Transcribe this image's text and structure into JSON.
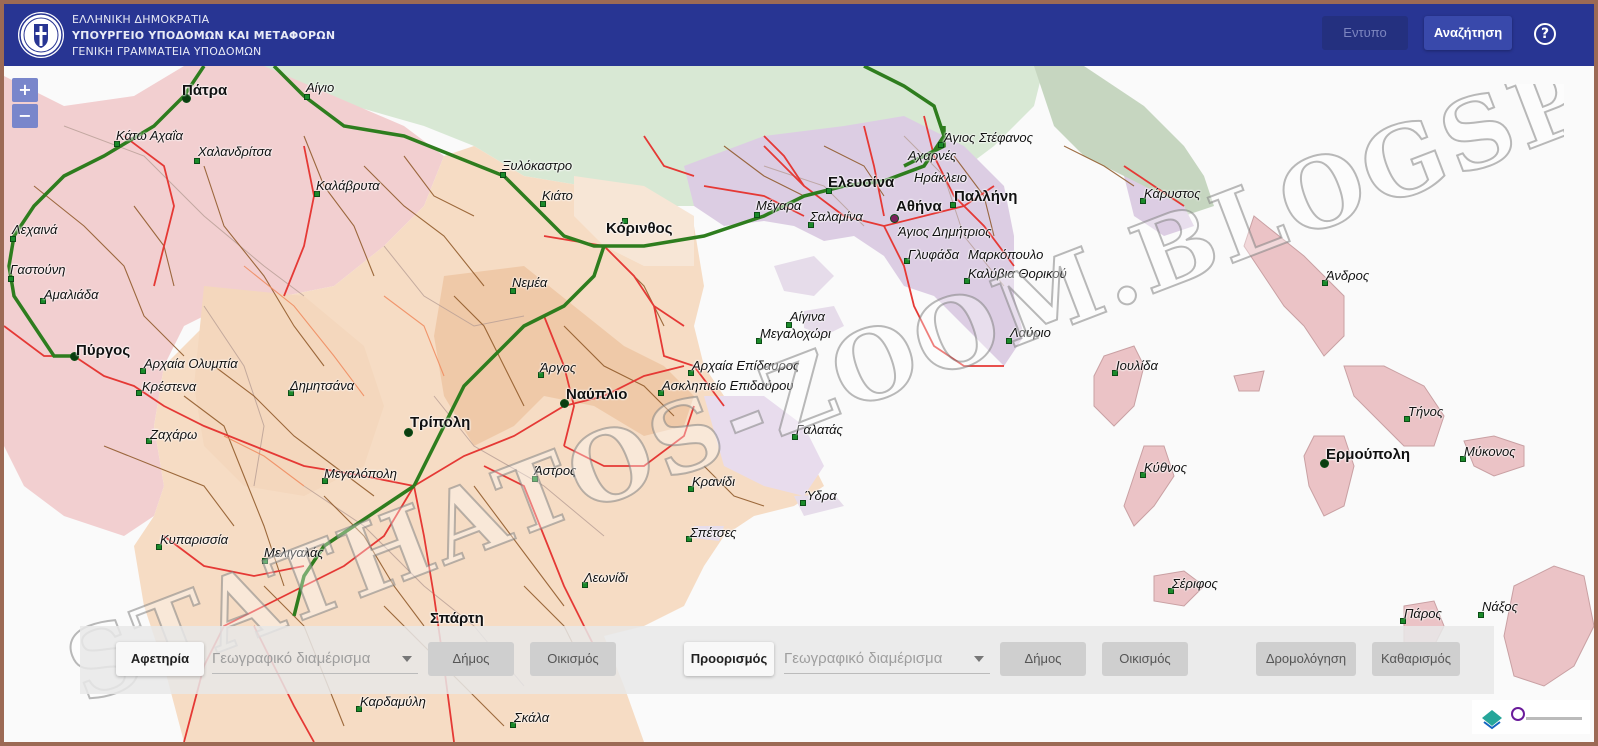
{
  "header": {
    "line1": "ΕΛΛΗΝΙΚΗ ΔΗΜΟΚΡΑΤΙΑ",
    "line2": "ΥΠΟΥΡΓΕΙΟ ΥΠΟΔΟΜΩΝ ΚΑΙ ΜΕΤΑΦΟΡΩΝ",
    "line3": "ΓΕΝΙΚΗ ΓΡΑΜΜΑΤΕΙΑ ΥΠΟΔΟΜΩΝ",
    "print_label": "Εντυπο",
    "search_label": "Αναζήτηση",
    "help_label": "?"
  },
  "zoom": {
    "in": "+",
    "out": "−"
  },
  "watermark": "STATHATOS-ZOOM.BLOGSPOT.GR",
  "places": {
    "patra": "Πάτρα",
    "aigio": "Αίγιο",
    "kato_achaia": "Κάτω Αχαΐα",
    "chalandritsa": "Χαλανδρίτσα",
    "kalavryta": "Καλάβρυτα",
    "xylokastro": "Ξυλόκαστρο",
    "kiato": "Κιάτο",
    "korinthos": "Κόρινθος",
    "lechaina": "Λεχαινά",
    "gastouni": "Γαστούνη",
    "amaliada": "Αμαλιάδα",
    "pyrgos": "Πύργος",
    "archaia_olympia": "Αρχαία Ολυμπία",
    "krestena": "Κρέστενα",
    "dimitsana": "Δημητσάνα",
    "zacharo": "Ζαχάρω",
    "nemea": "Νεμέα",
    "argos": "Άργος",
    "nafplio": "Ναύπλιο",
    "tripoli": "Τρίπολη",
    "megalopoli": "Μεγαλόπολη",
    "astros": "Άστρος",
    "kyparissia": "Κυπαρισσία",
    "meligalas": "Μελιγαλάς",
    "leonidi": "Λεωνίδι",
    "sparti": "Σπάρτη",
    "kardamyli": "Καρδαμύλη",
    "skala": "Σκάλα",
    "megara": "Μέγαρα",
    "salamina": "Σαλαμίνα",
    "elefsina": "Ελευσίνα",
    "athina": "Αθήνα",
    "acharnes": "Αχαρνές",
    "irakleio": "Ηράκλειο",
    "pallini": "Παλλήνη",
    "agios_stefanos": "Άγιος Στέφανος",
    "agios_dimitrios": "Άγιος Δημήτριος",
    "glyfada": "Γλυφάδα",
    "markopoulo": "Μαρκόπουλο",
    "kalyvia": "Καλύβια Θορικού",
    "lavrio": "Λαύριο",
    "aigina": "Αίγινα",
    "megalochori": "Μεγαλοχώρι",
    "archaia_epidavros": "Αρχαία Επίδαυρος",
    "asklipieio": "Ασκληπιείο Επιδαύρου",
    "galatas": "Γαλατάς",
    "kranidi": "Κρανίδι",
    "ydra": "Ύδρα",
    "spetses": "Σπέτσες",
    "karystos": "Κάρυστος",
    "andros": "Άνδρος",
    "ioulida": "Ιουλίδα",
    "tinos": "Τήνος",
    "ermoupoli": "Ερμούπολη",
    "mykonos": "Μύκονος",
    "kythnos": "Κύθνος",
    "serifos": "Σέριφος",
    "paros": "Πάρος",
    "naxos": "Νάξος"
  },
  "routebar": {
    "origin_label": "Αφετηρία",
    "origin_region_placeholder": "Γεωγραφικό διαμέρισμα",
    "origin_municipality": "Δήμος",
    "origin_settlement": "Οικισμός",
    "destination_label": "Προορισμός",
    "destination_region_placeholder": "Γεωγραφικό διαμέρισμα",
    "destination_municipality": "Δήμος",
    "destination_settlement": "Οικισμός",
    "route_button": "Δρομολόγηση",
    "clear_button": "Καθαρισμός"
  },
  "colors": {
    "header": "#283593",
    "highway": "#2e7d1e",
    "main_road": "#e53935",
    "local_road": "#8d5524",
    "region_achaia": "#f2cfd0",
    "region_peloponnese": "#f6dcc4",
    "region_attica": "#dccde3",
    "islands": "#ebc3c6"
  }
}
